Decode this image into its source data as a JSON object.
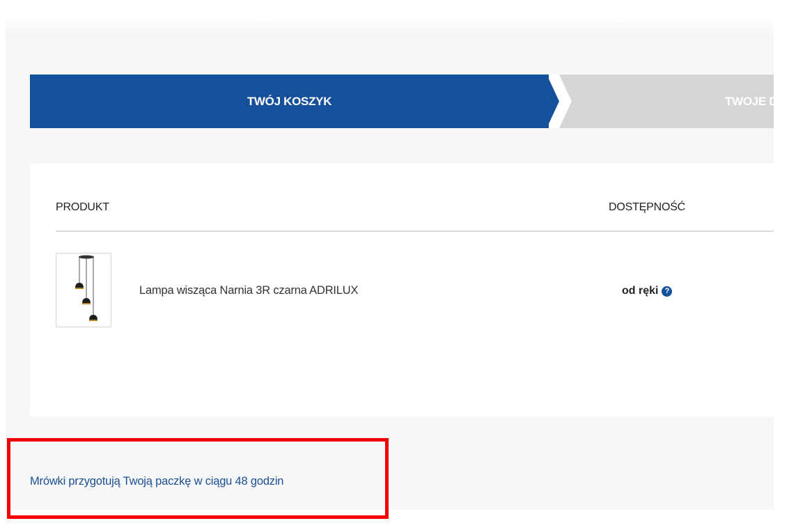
{
  "steps": [
    {
      "label": "TWÓJ KOSZYK",
      "active": true
    },
    {
      "label": "TWOJE D",
      "active": false
    }
  ],
  "cart_table": {
    "columns": [
      "PRODUKT",
      "DOSTĘPNOŚĆ"
    ],
    "rows": [
      {
        "product_name": "Lampa wisząca Narnia 3R czarna ADRILUX",
        "availability": "od ręki",
        "availability_icon": "help-icon"
      }
    ]
  },
  "info": {
    "text": "Mrówki przygotują Twoją paczkę w ciągu 48 godzin"
  },
  "colors": {
    "accent": "#15509b",
    "inactive_step": "#d5d5d5",
    "highlight": "#f30000",
    "link": "#1d4f91"
  }
}
